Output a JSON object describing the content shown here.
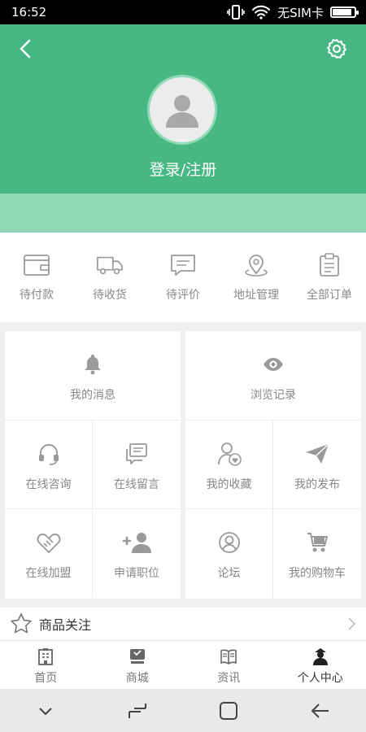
{
  "status_bar": {
    "time": "16:52",
    "carrier": "无SIM卡",
    "battery_level": 0.9
  },
  "header": {
    "login_label": "登录/注册"
  },
  "orders": [
    {
      "icon": "wallet-icon",
      "label": "待付款"
    },
    {
      "icon": "truck-icon",
      "label": "待收货"
    },
    {
      "icon": "comment-icon",
      "label": "待评价"
    },
    {
      "icon": "location-icon",
      "label": "地址管理"
    },
    {
      "icon": "clipboard-icon",
      "label": "全部订单"
    }
  ],
  "grid_left": {
    "top": {
      "icon": "bell-icon",
      "label": "我的消息"
    },
    "items": [
      {
        "icon": "headset-icon",
        "label": "在线咨询"
      },
      {
        "icon": "message-board-icon",
        "label": "在线留言"
      },
      {
        "icon": "handshake-icon",
        "label": "在线加盟"
      },
      {
        "icon": "add-user-icon",
        "label": "申请职位"
      }
    ]
  },
  "grid_right": {
    "top": {
      "icon": "eye-icon",
      "label": "浏览记录"
    },
    "items": [
      {
        "icon": "user-heart-icon",
        "label": "我的收藏"
      },
      {
        "icon": "paper-plane-icon",
        "label": "我的发布"
      },
      {
        "icon": "user-circle-icon",
        "label": "论坛"
      },
      {
        "icon": "cart-icon",
        "label": "我的购物车"
      }
    ]
  },
  "follow": {
    "icon": "star-icon",
    "label": "商品关注"
  },
  "tabbar": [
    {
      "icon": "building-icon",
      "label": "首页",
      "active": false
    },
    {
      "icon": "shop-icon",
      "label": "商城",
      "active": false
    },
    {
      "icon": "book-icon",
      "label": "资讯",
      "active": false
    },
    {
      "icon": "person-icon",
      "label": "个人中心",
      "active": true
    }
  ],
  "colors": {
    "primary": "#47b883",
    "band": "#8fd7b5",
    "icon_gray": "#9a9a9a"
  }
}
